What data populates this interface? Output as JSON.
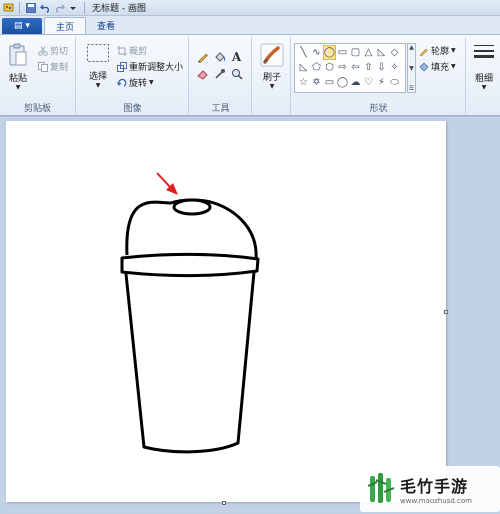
{
  "window": {
    "title": "无标题 - 画图"
  },
  "quick_access": {
    "icons": [
      "paint-app-icon",
      "save-icon",
      "undo-icon",
      "redo-icon",
      "customize-dropdown-icon"
    ]
  },
  "tabs": {
    "app_menu": "▤ ▾",
    "home": "主页",
    "view": "查看"
  },
  "clipboard": {
    "paste": "粘贴",
    "cut": "剪切",
    "copy": "复制",
    "label": "剪贴板"
  },
  "image": {
    "select": "选择",
    "crop": "裁剪",
    "resize": "重新调整大小",
    "rotate": "旋转",
    "label": "图像"
  },
  "tools": {
    "label": "工具",
    "items": [
      "pencil-icon",
      "fill-icon",
      "text-icon",
      "eraser-icon",
      "color-picker-icon",
      "magnifier-icon"
    ]
  },
  "brushes": {
    "label": "刷子"
  },
  "shapes": {
    "label": "形状",
    "outline": "轮廓",
    "fill": "填充",
    "glyphs": [
      "╲",
      "∿",
      "◯",
      "▭",
      "▢",
      "△",
      "◺",
      "◇",
      "◺",
      "⬠",
      "⬡",
      "⇨",
      "⇦",
      "⇧",
      "⇩",
      "✧",
      "☆",
      "✡",
      "▭",
      "◯",
      "☁",
      "♡",
      "⚡",
      "⬭"
    ],
    "selected_index": 2
  },
  "size": {
    "label": "粗细"
  },
  "watermark": {
    "name": "毛竹手游",
    "url": "www.maozhusd.com"
  },
  "colors": {
    "accent": "#1d4f9e",
    "arrow": "#e02020",
    "canvas": "#ffffff",
    "workspace": "#c2d1e5"
  }
}
